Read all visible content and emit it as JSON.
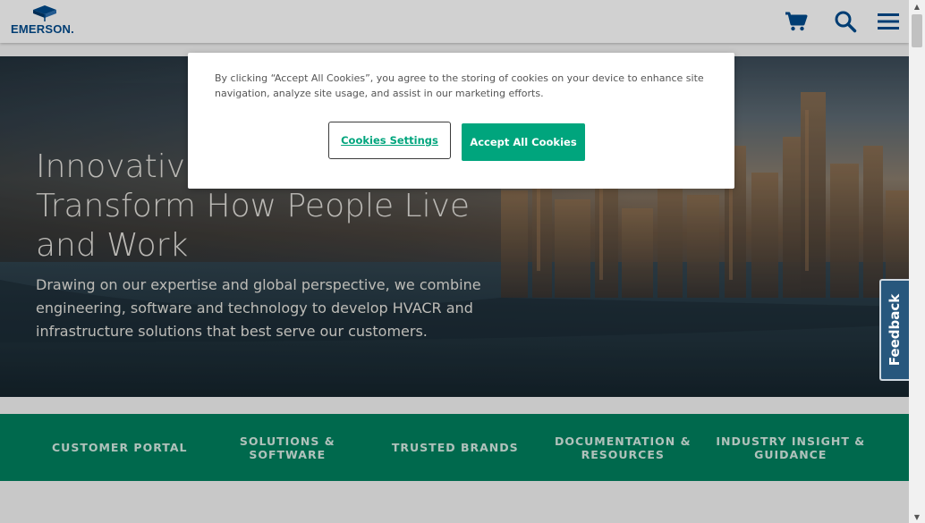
{
  "header": {
    "logo_text": "EMERSON.",
    "icons": [
      "cart-icon",
      "search-icon",
      "menu-icon"
    ]
  },
  "hero": {
    "title": "Innovative Solutions that Transform How People Live and Work",
    "description": "Drawing on our expertise and global perspective, we combine engineering, software and technology to develop HVACR and infrastructure solutions that best serve our customers."
  },
  "nav": {
    "items": [
      {
        "label": "CUSTOMER PORTAL"
      },
      {
        "label": "SOLUTIONS & SOFTWARE"
      },
      {
        "label": "TRUSTED BRANDS"
      },
      {
        "label": "DOCUMENTATION & RESOURCES"
      },
      {
        "label": "INDUSTRY INSIGHT & GUIDANCE"
      }
    ]
  },
  "cookie_banner": {
    "message": "By clicking “Accept All Cookies”, you agree to the storing of cookies on your device to enhance site navigation, analyze site usage, and assist in our marketing efforts.",
    "settings_label": "Cookies Settings",
    "accept_label": "Accept All Cookies"
  },
  "feedback": {
    "label": "Feedback"
  },
  "colors": {
    "brand_blue": "#004b8d",
    "nav_green": "#00805f",
    "accept_green": "#00a57d",
    "feedback_blue": "#27577d"
  }
}
